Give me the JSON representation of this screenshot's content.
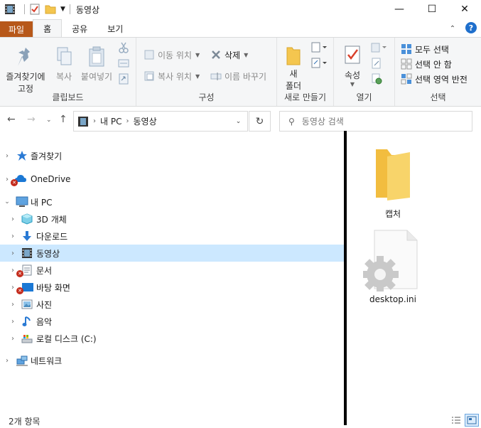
{
  "window": {
    "title": "동영상",
    "controls": {
      "minimize": "—",
      "maximize": "☐",
      "close": "✕"
    }
  },
  "ribbon_tabs": [
    {
      "label": "파일"
    },
    {
      "label": "홈"
    },
    {
      "label": "공유"
    },
    {
      "label": "보기"
    }
  ],
  "ribbon": {
    "clipboard": {
      "label": "클립보드",
      "pin_label_line1": "즐겨찾기에",
      "pin_label_line2": "고정",
      "copy": "복사",
      "paste": "붙여넣기"
    },
    "organize": {
      "label": "구성",
      "move_to": "이동 위치",
      "copy_to": "복사 위치",
      "delete": "삭제",
      "rename": "이름 바꾸기"
    },
    "new": {
      "label": "새로 만들기",
      "new_folder_line1": "새",
      "new_folder_line2": "폴더"
    },
    "open": {
      "label": "열기",
      "properties": "속성"
    },
    "select": {
      "label": "선택",
      "select_all": "모두 선택",
      "select_none": "선택 안 함",
      "invert": "선택 영역 반전"
    }
  },
  "address": {
    "segments": [
      "내 PC",
      "동영상"
    ],
    "search_placeholder": "동영상 검색"
  },
  "nav_tree": {
    "quick_access": "즐겨찾기",
    "onedrive": "OneDrive",
    "this_pc": "내 PC",
    "objects3d": "3D 개체",
    "downloads": "다운로드",
    "videos": "동영상",
    "documents": "문서",
    "desktop": "바탕 화면",
    "pictures": "사진",
    "music": "음악",
    "local_disk": "로컬 디스크 (C:)",
    "network": "네트워크"
  },
  "files": [
    {
      "name": "캡처",
      "icon": "folder-icon"
    },
    {
      "name": "desktop.ini",
      "icon": "settings-file-icon"
    }
  ],
  "status": {
    "item_count": "2개 항목"
  },
  "colors": {
    "file_tab": "#b7581a",
    "selection": "#cce8ff",
    "folder": "#f4c64f",
    "error_badge": "#c42b1c"
  }
}
